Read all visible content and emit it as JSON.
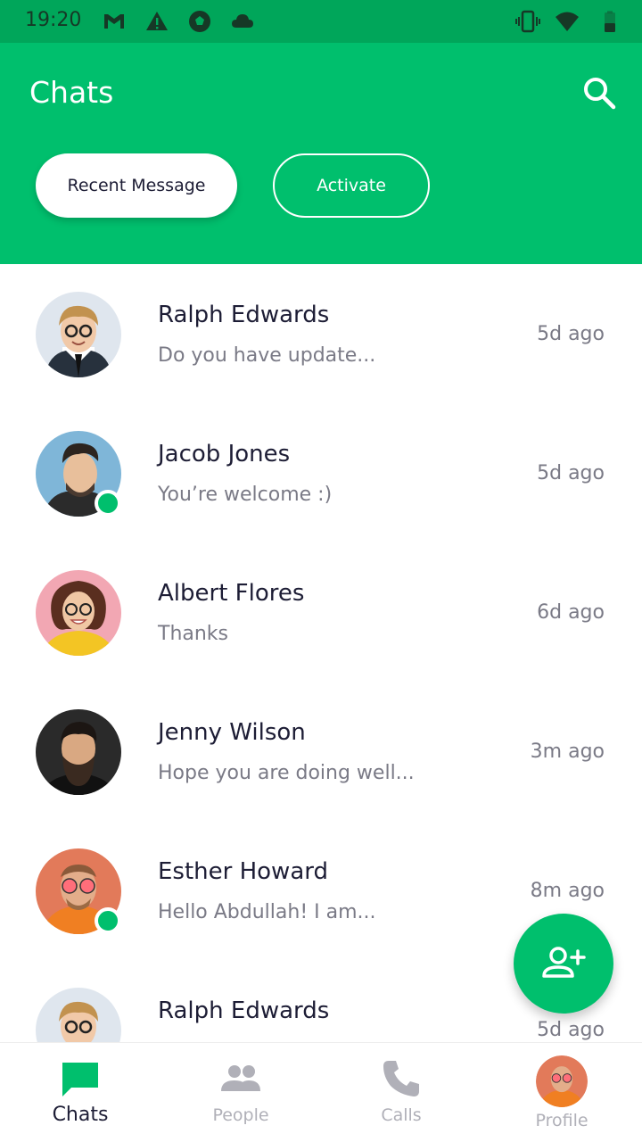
{
  "status_bar": {
    "time": "19:20"
  },
  "header": {
    "title": "Chats",
    "filters": [
      {
        "label": "Recent Message",
        "selected": true
      },
      {
        "label": "Activate",
        "selected": false
      }
    ]
  },
  "chats": [
    {
      "name": "Ralph Edwards",
      "message": "Do you have update...",
      "time": "5d ago",
      "online": false
    },
    {
      "name": "Jacob Jones",
      "message": "You’re welcome :)",
      "time": "5d ago",
      "online": true
    },
    {
      "name": "Albert Flores",
      "message": "Thanks",
      "time": "6d ago",
      "online": false
    },
    {
      "name": "Jenny Wilson",
      "message": "Hope you are doing well...",
      "time": "3m ago",
      "online": false
    },
    {
      "name": "Esther Howard",
      "message": "Hello Abdullah! I am...",
      "time": "8m ago",
      "online": true
    },
    {
      "name": "Ralph Edwards",
      "message": "",
      "time": "5d ago",
      "online": false
    }
  ],
  "bottom_nav": {
    "items": [
      {
        "label": "Chats",
        "icon": "chat-bubble-icon",
        "active": true
      },
      {
        "label": "People",
        "icon": "people-icon",
        "active": false
      },
      {
        "label": "Calls",
        "icon": "phone-icon",
        "active": false
      },
      {
        "label": "Profile",
        "icon": "avatar",
        "active": false
      }
    ]
  },
  "colors": {
    "primary": "#00bf6d",
    "status_bar": "#00a65a",
    "text": "#1d1d35",
    "muted": "#7a7a86"
  }
}
